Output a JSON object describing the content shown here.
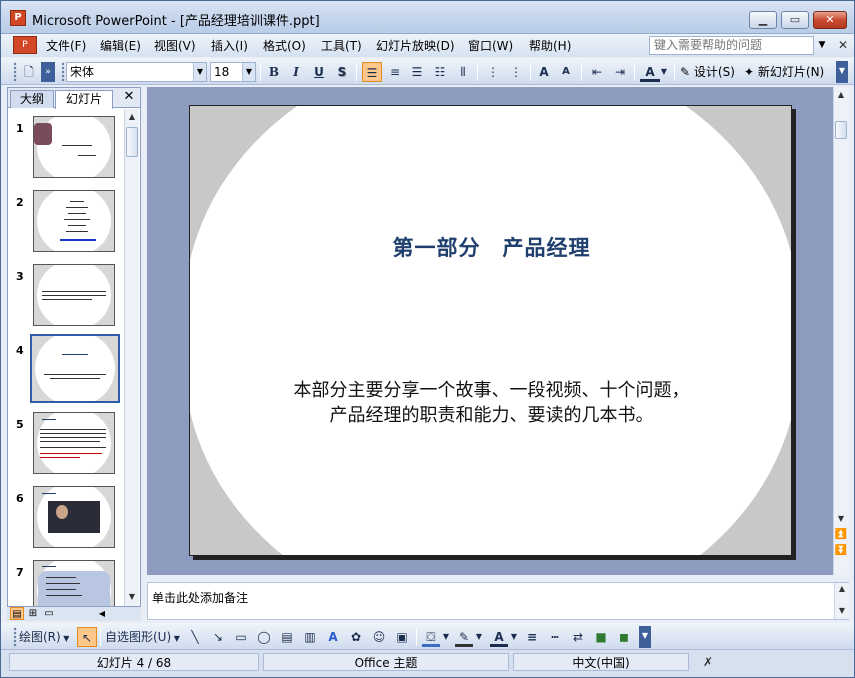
{
  "window": {
    "title": "Microsoft PowerPoint - [产品经理培训课件.ppt]",
    "app_icon": "P"
  },
  "menu": {
    "items": [
      "文件(F)",
      "编辑(E)",
      "视图(V)",
      "插入(I)",
      "格式(O)",
      "工具(T)",
      "幻灯片放映(D)",
      "窗口(W)",
      "帮助(H)"
    ],
    "help_placeholder": "键入需要帮助的问题"
  },
  "toolbar": {
    "font_name": "宋体",
    "font_size": "18",
    "bold": "B",
    "italic": "I",
    "underline": "U",
    "shadow": "S",
    "design_label": "设计(S)",
    "new_slide_label": "新幻灯片(N)"
  },
  "panel": {
    "tabs": [
      "大纲",
      "幻灯片"
    ],
    "active_tab": "幻灯片",
    "slides": [
      "1",
      "2",
      "3",
      "4",
      "5",
      "6",
      "7"
    ],
    "selected_slide": "4"
  },
  "slide": {
    "title": "第一部分　产品经理",
    "body_lines": [
      "本部分主要分享一个故事、一段视频、十个问题，",
      "产品经理的职责和能力、要读的几本书。"
    ]
  },
  "notes": {
    "placeholder": "单击此处添加备注"
  },
  "drawing_toolbar": {
    "draw_label": "绘图(R)",
    "autoshapes_label": "自选图形(U)"
  },
  "status": {
    "slide_position": "幻灯片 4 / 68",
    "theme": "Office 主题",
    "language": "中文(中国)"
  },
  "colors": {
    "slide_title": "#1f3f6e",
    "selection": "#2f5ca8",
    "stage_bg": "#8d9cbf"
  }
}
